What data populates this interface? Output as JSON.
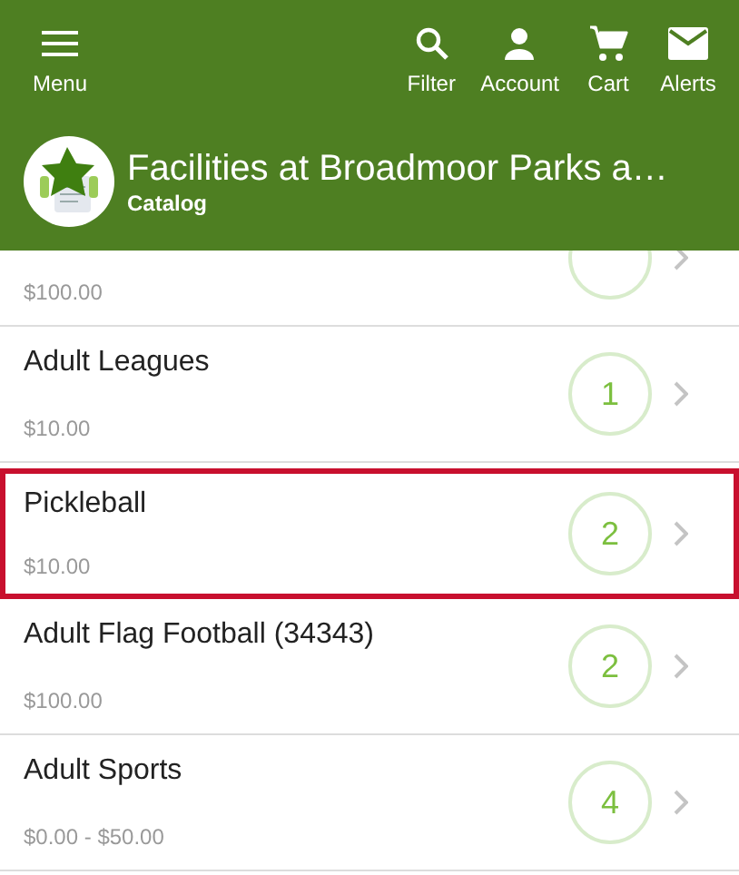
{
  "top_bar": {
    "menu": {
      "label": "Menu"
    },
    "actions": [
      {
        "kind": "filter",
        "label": "Filter"
      },
      {
        "kind": "account",
        "label": "Account"
      },
      {
        "kind": "cart",
        "label": "Cart"
      },
      {
        "kind": "alerts",
        "label": "Alerts"
      }
    ]
  },
  "header": {
    "title": "Facilities at Broadmoor Parks a…",
    "subtitle": "Catalog"
  },
  "items": [
    {
      "price": "$100.00",
      "selected": false
    },
    {
      "title": "Adult Leagues",
      "price": "$10.00",
      "count": "1",
      "selected": false
    },
    {
      "title": "Pickleball",
      "price": "$10.00",
      "count": "2",
      "selected": true
    },
    {
      "title": "Adult Flag Football (34343)",
      "price": "$100.00",
      "count": "2",
      "selected": false
    },
    {
      "title": "Adult Sports",
      "price": "$0.00 - $50.00",
      "count": "4",
      "selected": false
    }
  ]
}
